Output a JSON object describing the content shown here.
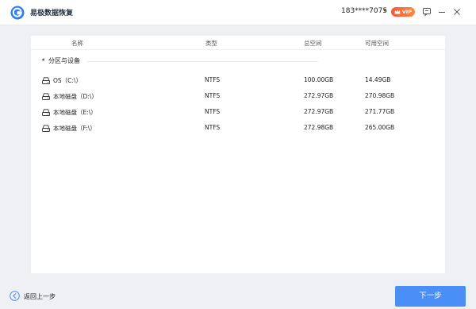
{
  "app": {
    "title": "易极数据恢复",
    "account": "183****7075",
    "vip_label": "VIP",
    "accent_color": "#4a8ff7"
  },
  "table": {
    "columns": {
      "name": "名称",
      "type": "类型",
      "total": "总空间",
      "free": "可用空间"
    },
    "group_label": "分区与设备",
    "rows": [
      {
        "name": "OS（C:\\）",
        "type": "NTFS",
        "total": "100.00GB",
        "free": "14.49GB",
        "icon": "os-drive-icon"
      },
      {
        "name": "本地磁盘（D:\\）",
        "type": "NTFS",
        "total": "272.97GB",
        "free": "270.98GB",
        "icon": "hard-drive-icon"
      },
      {
        "name": "本地磁盘（E:\\）",
        "type": "NTFS",
        "total": "272.97GB",
        "free": "271.77GB",
        "icon": "hard-drive-icon"
      },
      {
        "name": "本地磁盘（F:\\）",
        "type": "NTFS",
        "total": "272.98GB",
        "free": "265.00GB",
        "icon": "hard-drive-icon"
      }
    ]
  },
  "footer": {
    "back_label": "返回上一步",
    "next_label": "下一步"
  }
}
